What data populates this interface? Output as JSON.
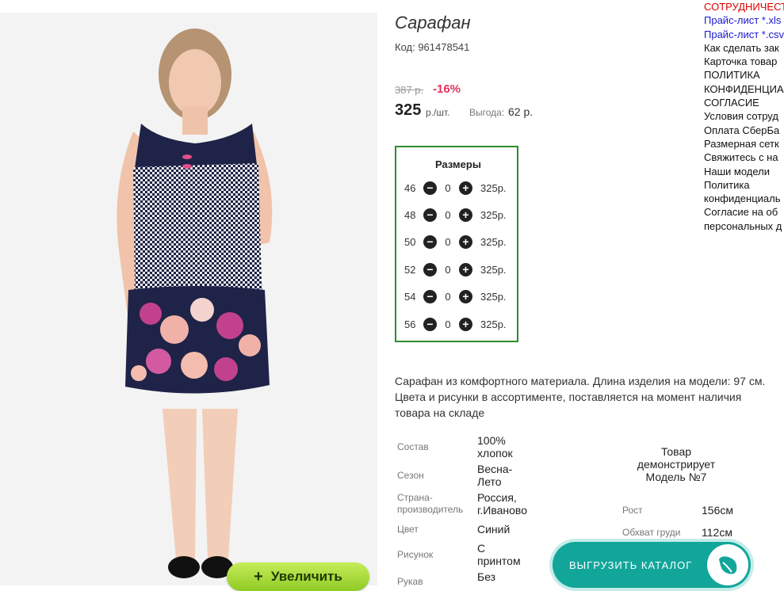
{
  "product": {
    "title": "Сарафан",
    "code": "Код: 961478541",
    "old_price": "387 р.",
    "discount": "-16%",
    "price": "325",
    "price_unit": "р./шт.",
    "benefit_label": "Выгода:",
    "benefit_value": "62 р.",
    "zoom_label": "Увеличить",
    "zoom_icon": "+",
    "description": "Сарафан из комфортного материала. Длина изделия на модели: 97 см. Цвета и рисунки в ассортименте, поставляется на момент наличия товара на складе"
  },
  "sizes": {
    "title": "Размеры",
    "rows": [
      {
        "size": "46",
        "qty": "0",
        "price": "325р."
      },
      {
        "size": "48",
        "qty": "0",
        "price": "325р."
      },
      {
        "size": "50",
        "qty": "0",
        "price": "325р."
      },
      {
        "size": "52",
        "qty": "0",
        "price": "325р."
      },
      {
        "size": "54",
        "qty": "0",
        "price": "325р."
      },
      {
        "size": "56",
        "qty": "0",
        "price": "325р."
      }
    ],
    "minus_glyph": "−",
    "plus_glyph": "+"
  },
  "specs": [
    {
      "label": "Состав",
      "value": "100% хлопок"
    },
    {
      "label": "Сезон",
      "value": "Весна-Лето"
    },
    {
      "label": "Страна-производитель",
      "value": "Россия, г.Иваново"
    },
    {
      "label": "Цвет",
      "value": "Синий"
    },
    {
      "label": "Рисунок",
      "value": "С принтом"
    },
    {
      "label": "Рукав",
      "value": "Без"
    }
  ],
  "model": {
    "caption": "Товар демонстрирует Модель №7",
    "height_label": "Рост",
    "height_value": "156см",
    "chest_label": "Обхват груди",
    "chest_value": "112см"
  },
  "export_button": {
    "label": "ВЫГРУЗИТЬ КАТАЛОГ",
    "icon": "leaf-icon"
  },
  "right_nav": [
    "СОТРУДНИЧЕСТ",
    "Прайс-лист *.xls",
    "Прайс-лист *.csv",
    "Как сделать зак",
    "Карточка товар",
    "ПОЛИТИКА",
    "КОНФИДЕНЦИА",
    "СОГЛАСИЕ",
    "Условия сотруд",
    "Оплата СберБа",
    "Размерная сетк",
    "Свяжитесь с на",
    "Наши модели",
    "Политика",
    "конфиденциаль",
    "Согласие на об",
    "персональных д"
  ],
  "colors": {
    "accent_green": "#2e8b2e",
    "discount_red": "#e0335d",
    "export_teal": "#12a69b"
  }
}
